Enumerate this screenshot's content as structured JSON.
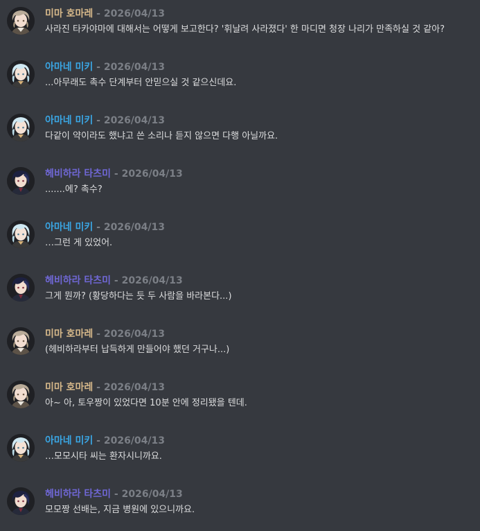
{
  "colors": {
    "background": "#36393f",
    "mima": "#d6b88a",
    "amane": "#3aa6e4",
    "hebihara": "#6f67d4",
    "date": "#7b7f86",
    "text": "#dcddde"
  },
  "separator": "-",
  "messages": [
    {
      "author": "미마 호마레",
      "character": "mima",
      "date": "2026/04/13",
      "text": "사라진 타카야마에 대해서는 어떻게 보고한다? '휘날려 사라졌다' 한 마디면 청장 나리가 만족하실 것 같아?"
    },
    {
      "author": "아마네 미키",
      "character": "amane",
      "date": "2026/04/13",
      "text": "...아무래도 촉수 단계부터 안믿으실 것 같으신데요."
    },
    {
      "author": "아마네 미키",
      "character": "amane",
      "date": "2026/04/13",
      "text": "다같이 약이라도 했냐고 쓴 소리나 듣지 않으면 다행 아닐까요."
    },
    {
      "author": "헤비하라 타츠미",
      "character": "hebihara",
      "date": "2026/04/13",
      "text": ".......에? 촉수?"
    },
    {
      "author": "아마네 미키",
      "character": "amane",
      "date": "2026/04/13",
      "text": "…그런 게 있었어."
    },
    {
      "author": "헤비하라 타츠미",
      "character": "hebihara",
      "date": "2026/04/13",
      "text": "그게 뭔까? (황당하다는 듯 두 사람을 바라본다...)"
    },
    {
      "author": "미마 호마레",
      "character": "mima",
      "date": "2026/04/13",
      "text": "(헤비하라부터 납득하게 만들어야 했던 거구나...)"
    },
    {
      "author": "미마 호마레",
      "character": "mima",
      "date": "2026/04/13",
      "text": "아~ 아, 토우짱이 있었다면 10분 안에 정리됐을 텐데."
    },
    {
      "author": "아마네 미키",
      "character": "amane",
      "date": "2026/04/13",
      "text": "…모모시타 씨는 환자시니까요."
    },
    {
      "author": "헤비하라 타츠미",
      "character": "hebihara",
      "date": "2026/04/13",
      "text": "모모짱 선배는, 지금 병원에 있으니까요."
    }
  ]
}
